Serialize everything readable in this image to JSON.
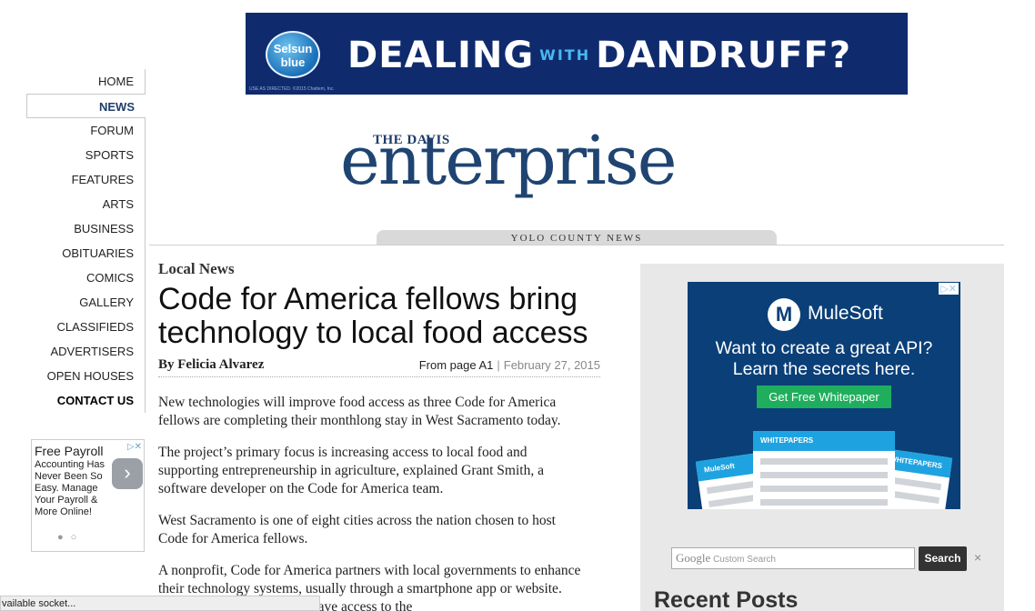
{
  "top_ad": {
    "brand": "Selsun blue",
    "headline_part1": "DEALING",
    "headline_with": "WITH",
    "headline_part2": "DANDRUFF?",
    "fine_print": "USE AS DIRECTED. ©2015 Chattem, Inc.",
    "background": "#0f2b6e"
  },
  "nav": {
    "items": [
      {
        "label": "HOME"
      },
      {
        "label": "NEWS",
        "active": true
      },
      {
        "label": "FORUM"
      },
      {
        "label": "SPORTS"
      },
      {
        "label": "FEATURES"
      },
      {
        "label": "ARTS"
      },
      {
        "label": "BUSINESS"
      },
      {
        "label": "OBITUARIES"
      },
      {
        "label": "COMICS"
      },
      {
        "label": "GALLERY"
      },
      {
        "label": "CLASSIFIEDS"
      },
      {
        "label": "ADVERTISERS"
      },
      {
        "label": "OPEN HOUSES"
      },
      {
        "label": "CONTACT US"
      }
    ]
  },
  "left_ad": {
    "title": "Free Payroll",
    "body": "Accounting Has Never Been So Easy. Manage Your Payroll & More Online!",
    "arrow": "›"
  },
  "masthead": {
    "the_davis": "THE DAVIS",
    "wordmark": "enterprise",
    "tagline": "YOLO COUNTY NEWS",
    "color": "#1f4472"
  },
  "article": {
    "section": "Local News",
    "title": "Code for America fellows bring technology to local food access",
    "byline": "By Felicia Alvarez",
    "page_ref": "From page A1",
    "separator": "|",
    "date": "February 27, 2015",
    "paragraphs": [
      "New technologies will improve food access as three Code for America fellows are completing their monthlong stay in West Sacramento today.",
      "The project’s primary focus is increasing access to local food and supporting entrepreneurship in agriculture, explained Grant Smith, a software developer on the Code for America team.",
      "West Sacramento is one of eight cities across the nation chosen to host Code for America fellows.",
      "A nonprofit, Code for America partners with local governments to enhance their technology systems, usually through a smartphone app or website. The demographic that will have access to the"
    ]
  },
  "right_ad": {
    "brand": "MuleSoft",
    "line1": "Want to create a great API?",
    "line2": "Learn the secrets here.",
    "cta": "Get Free Whitepaper",
    "card_label_center": "WHITEPAPERS",
    "card_label_right": "WHITEPAPERS",
    "card_label_left": "MuleSoft",
    "background": "#0a3f78",
    "cta_color": "#1fae5d"
  },
  "search": {
    "google": "Google",
    "placeholder": "Custom Search",
    "button": "Search",
    "clear": "×"
  },
  "sidebar": {
    "recent_posts": "Recent Posts"
  },
  "status_bar": {
    "text": "vailable socket..."
  }
}
